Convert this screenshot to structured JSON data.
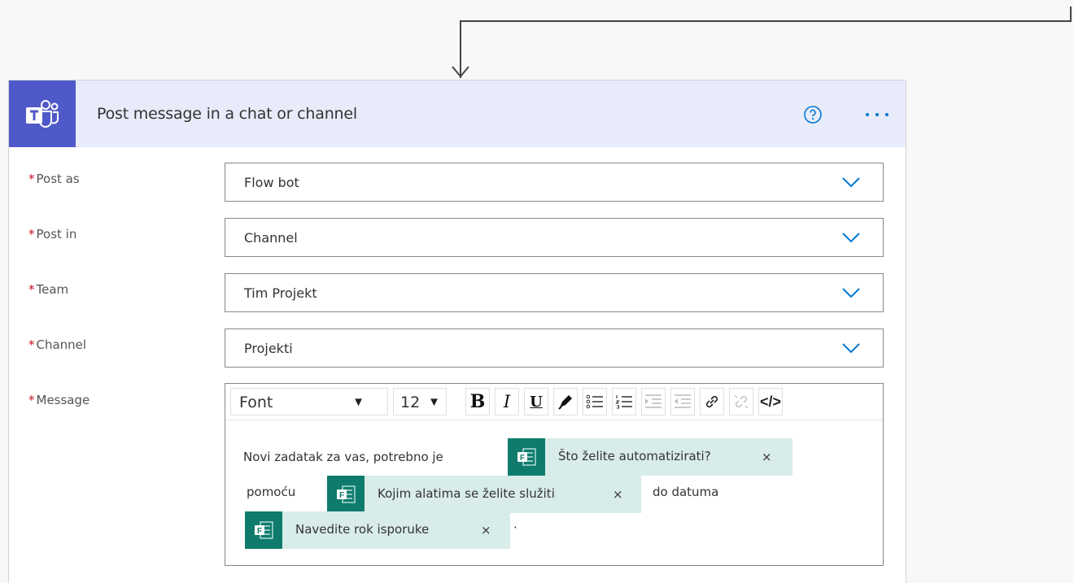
{
  "action": {
    "title": "Post message in a chat or channel",
    "help_icon": "help-circle-icon",
    "more_icon": "more-ellipsis-icon",
    "logo_icon": "microsoft-teams-icon",
    "brand_color": "#5059c9",
    "header_color": "#e8ebfa"
  },
  "required_marker": "*",
  "fields": {
    "post_as": {
      "label": "Post as",
      "value": "Flow bot"
    },
    "post_in": {
      "label": "Post in",
      "value": "Channel"
    },
    "team": {
      "label": "Team",
      "value": "Tim Projekt"
    },
    "channel": {
      "label": "Channel",
      "value": "Projekti"
    },
    "message": {
      "label": "Message"
    }
  },
  "toolbar": {
    "font": "Font",
    "size": "12",
    "bold": "B",
    "italic": "I",
    "underline": "U",
    "code": "</>"
  },
  "message": {
    "text_1": "Novi zadatak za vas, potrebno je",
    "text_2": "pomoću",
    "text_3": "do datuma",
    "text_4": "·",
    "token_1": "Što želite automatizirati?",
    "token_2": "Kojim alatima se želite služiti",
    "token_3": "Navedite rok isporuke",
    "token_close": "×",
    "token_icon": "microsoft-forms-icon",
    "token_color": "#0f7b6c"
  }
}
